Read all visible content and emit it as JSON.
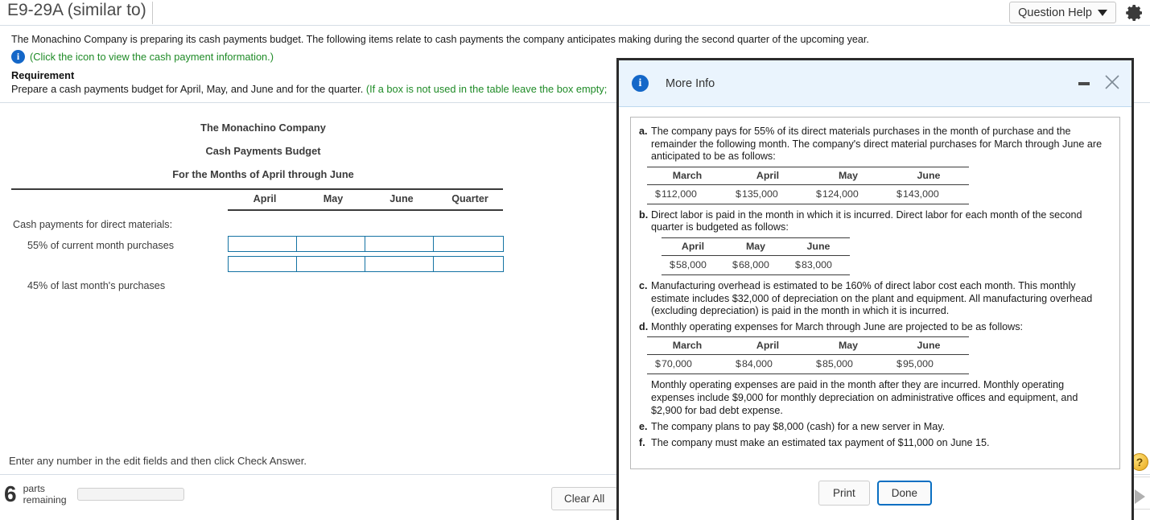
{
  "header": {
    "exercise_title": "E9-29A (similar to)",
    "question_help_label": "Question Help",
    "gear_icon": "gear-icon",
    "caret_icon": "chevron-down-icon"
  },
  "statement": {
    "intro": "The Monachino Company is preparing its cash payments budget. The following items relate to cash payments the company anticipates making during the second quarter of the upcoming year.",
    "info_icon": "info-icon",
    "info_link": "(Click the icon to view the cash payment information.)",
    "requirement_label": "Requirement",
    "requirement_text": "Prepare a cash payments budget for April, May, and June and for the quarter.",
    "requirement_hint": "(If a box is not used in the table leave the box empty;"
  },
  "worksheet": {
    "title_line1": "The Monachino Company",
    "title_line2": "Cash Payments Budget",
    "title_line3": "For the Months of April through June",
    "columns": [
      "April",
      "May",
      "June",
      "Quarter"
    ],
    "section_label": "Cash payments for direct materials:",
    "rows": [
      {
        "label": "55% of current month purchases",
        "values": [
          "",
          "",
          "",
          ""
        ]
      },
      {
        "label": "45% of last month's purchases",
        "values": [
          "",
          "",
          "",
          ""
        ]
      }
    ]
  },
  "footer": {
    "note": "Enter any number in the edit fields and then click Check Answer.",
    "parts_count": "6",
    "parts_label_line1": "parts",
    "parts_label_line2": "remaining",
    "progress_percent": 12,
    "clear_all_label": "Clear All",
    "help_badge": "?",
    "next_arrow_icon": "play-arrow-icon"
  },
  "modal": {
    "title": "More Info",
    "info_icon": "info-icon",
    "minimize_icon": "minimize-icon",
    "close_icon": "close-icon",
    "items": [
      {
        "marker": "a.",
        "text": "The company pays for 55% of its direct materials purchases in the month of purchase and the remainder the following month. The company's direct material purchases for March through June are anticipated to be as follows:",
        "table": {
          "headers": [
            "March",
            "April",
            "May",
            "June"
          ],
          "currency": "$",
          "values": [
            "112,000",
            "135,000",
            "124,000",
            "143,000"
          ]
        }
      },
      {
        "marker": "b.",
        "text": "Direct labor is paid in the month in which it is incurred. Direct labor for each month of the second quarter is budgeted as follows:",
        "table": {
          "headers": [
            "April",
            "May",
            "June"
          ],
          "currency": "$",
          "values": [
            "58,000",
            "68,000",
            "83,000"
          ]
        }
      },
      {
        "marker": "c.",
        "text": "Manufacturing overhead is estimated to be 160% of direct labor cost each month. This monthly estimate includes $32,000 of depreciation on the plant and equipment. All manufacturing overhead (excluding depreciation) is paid in the month in which it is incurred."
      },
      {
        "marker": "d.",
        "text": "Monthly operating expenses for March through June are projected to be as follows:",
        "table": {
          "headers": [
            "March",
            "April",
            "May",
            "June"
          ],
          "currency": "$",
          "values": [
            "70,000",
            "84,000",
            "85,000",
            "95,000"
          ]
        },
        "note": "Monthly operating expenses are paid in the month after they are incurred. Monthly operating expenses include $9,000 for monthly depreciation on administrative offices and equipment, and $2,900 for bad debt expense."
      },
      {
        "marker": "e.",
        "text": "The company plans to pay $8,000 (cash) for a new server in May."
      },
      {
        "marker": "f.",
        "text": "The company must make an estimated tax payment of $11,000 on June 15."
      }
    ],
    "print_label": "Print",
    "done_label": "Done"
  },
  "colors": {
    "accent_blue": "#1467c8",
    "link_green": "#1f8b27",
    "input_border": "#1573a3",
    "modal_header_bg": "#eaf4fd",
    "primary_button_border": "#0a6fc2",
    "progress_fill": "#2380d4"
  }
}
